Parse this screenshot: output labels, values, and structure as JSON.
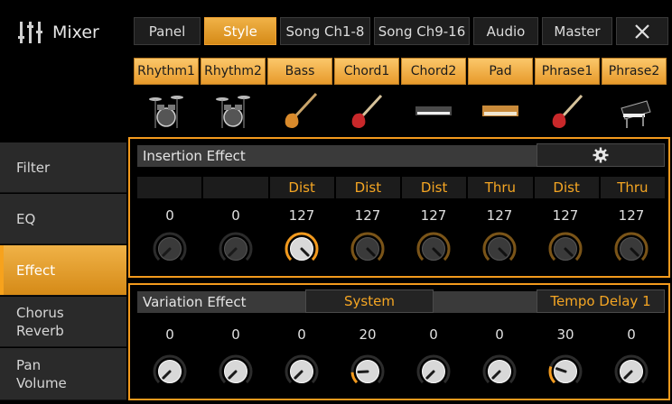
{
  "app": {
    "title": "Mixer"
  },
  "tabs": [
    {
      "label": "Panel",
      "active": false
    },
    {
      "label": "Style",
      "active": true
    },
    {
      "label": "Song Ch1-8",
      "active": false
    },
    {
      "label": "Song Ch9-16",
      "active": false
    },
    {
      "label": "Audio",
      "active": false
    },
    {
      "label": "Master",
      "active": false
    }
  ],
  "parts": [
    {
      "label": "Rhythm1",
      "icon": "drum-kit-icon"
    },
    {
      "label": "Rhythm2",
      "icon": "drum-kit-icon"
    },
    {
      "label": "Bass",
      "icon": "bass-guitar-icon"
    },
    {
      "label": "Chord1",
      "icon": "electric-guitar-icon"
    },
    {
      "label": "Chord2",
      "icon": "keyboard-icon"
    },
    {
      "label": "Pad",
      "icon": "synth-icon"
    },
    {
      "label": "Phrase1",
      "icon": "electric-guitar-icon"
    },
    {
      "label": "Phrase2",
      "icon": "grand-piano-icon"
    }
  ],
  "sidebar": [
    {
      "label": "Filter",
      "active": false
    },
    {
      "label": "EQ",
      "active": false
    },
    {
      "label": "Effect",
      "active": true
    },
    {
      "label": "Chorus\nReverb",
      "active": false
    },
    {
      "label": "Pan\nVolume",
      "active": false
    }
  ],
  "insertion": {
    "title": "Insertion Effect",
    "types": [
      "",
      "",
      "Dist",
      "Dist",
      "Dist",
      "Thru",
      "Dist",
      "Thru"
    ],
    "values": [
      "0",
      "0",
      "127",
      "127",
      "127",
      "127",
      "127",
      "127"
    ],
    "knob_levels": [
      0,
      0,
      1,
      1,
      1,
      1,
      1,
      1
    ],
    "selected_index": 2
  },
  "variation": {
    "title": "Variation Effect",
    "system_label": "System",
    "type_label": "Tempo Delay 1",
    "values": [
      "0",
      "0",
      "0",
      "20",
      "0",
      "0",
      "30",
      "0"
    ],
    "knob_levels": [
      0,
      0,
      0,
      0.157,
      0,
      0,
      0.236,
      0
    ]
  },
  "colors": {
    "accent": "#f39a1d",
    "active_tab": "#e69a2a"
  }
}
